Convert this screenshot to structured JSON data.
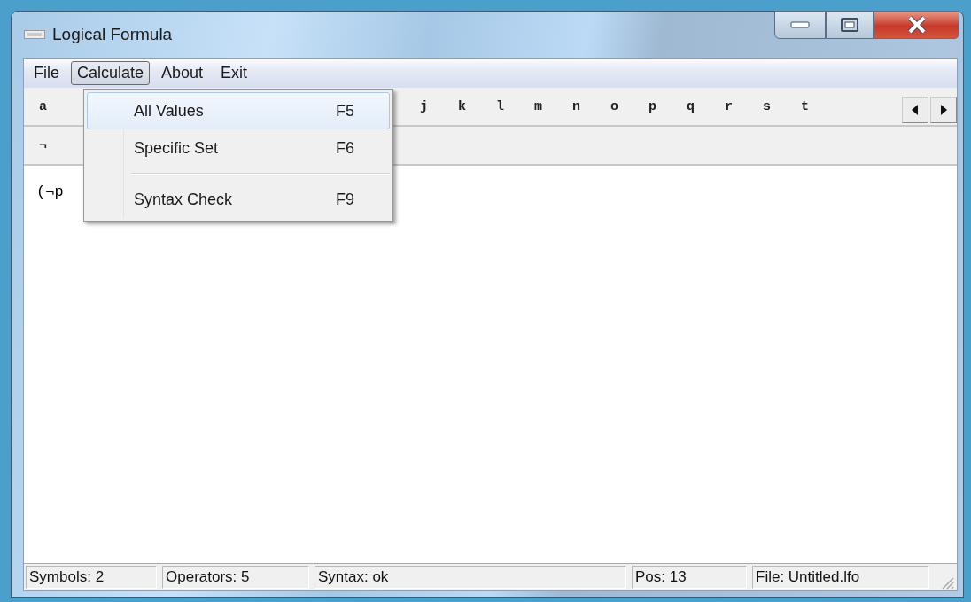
{
  "window": {
    "title": "Logical Formula"
  },
  "menu_bar": [
    {
      "label": "File",
      "selected": false
    },
    {
      "label": "Calculate",
      "selected": true
    },
    {
      "label": "About",
      "selected": false
    },
    {
      "label": "Exit",
      "selected": false
    }
  ],
  "dropdown": [
    {
      "kind": "item",
      "label": "All Values",
      "shortcut": "F5",
      "selected": true
    },
    {
      "kind": "item",
      "label": "Specific Set",
      "shortcut": "F6",
      "selected": false
    },
    {
      "kind": "separator"
    },
    {
      "kind": "item",
      "label": "Syntax Check",
      "shortcut": "F9",
      "selected": false
    }
  ],
  "symbol_row": {
    "items_before_menu": [
      "a"
    ],
    "items_after_menu": [
      "j",
      "k",
      "l",
      "m",
      "n",
      "o",
      "p",
      "q",
      "r",
      "s",
      "t"
    ]
  },
  "operator_row": {
    "items": [
      "¬"
    ]
  },
  "editor": {
    "value": "(¬p"
  },
  "status_bar": [
    "Symbols: 2",
    "Operators: 5",
    "Syntax: ok",
    "Pos: 13",
    "File: Untitled.lfo"
  ]
}
